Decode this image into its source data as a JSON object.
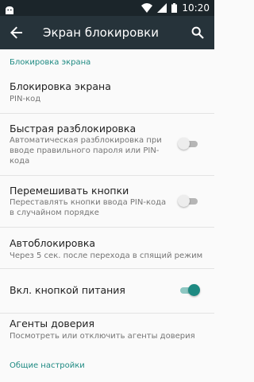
{
  "statusbar": {
    "time": "10:20"
  },
  "toolbar": {
    "title": "Экран блокировки"
  },
  "sections": {
    "lock_screen_header": "Блокировка экрана",
    "general_header": "Общие настройки"
  },
  "items": {
    "screen_lock": {
      "title": "Блокировка экрана",
      "summary": "PIN-код"
    },
    "quick_unlock": {
      "title": "Быстрая разблокировка",
      "summary": "Автоматическая разблокировка при вводе правильного пароля или PIN-кода",
      "enabled": false
    },
    "shuffle_keys": {
      "title": "Перемешивать кнопки",
      "summary": "Переставлять кнопки ввода PIN-кода в случайном порядке",
      "enabled": false
    },
    "auto_lock": {
      "title": "Автоблокировка",
      "summary": "Через 5 сек. после перехода в спящий режим"
    },
    "power_button_lock": {
      "title": "Вкл. кнопкой питания",
      "enabled": true
    },
    "trust_agents": {
      "title": "Агенты доверия",
      "summary": "Посмотреть или отключить агенты доверия"
    }
  },
  "colors": {
    "accent": "#1e8a82",
    "toolbar": "#26333a",
    "statusbar": "#1b252a"
  },
  "icons": {
    "status_left": "android-head-icon",
    "status_right": [
      "wifi-icon",
      "signal-icon",
      "battery-icon"
    ],
    "toolbar_left": "back-arrow-icon",
    "toolbar_right": "search-icon"
  }
}
